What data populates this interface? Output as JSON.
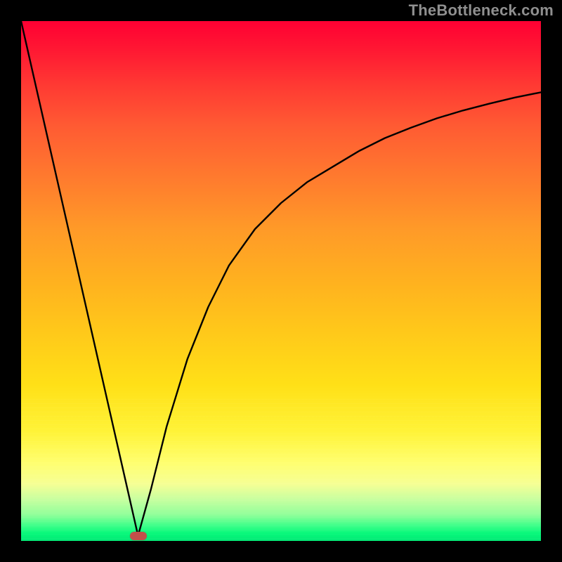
{
  "watermark": "TheBottleneck.com",
  "marker": {
    "x_pct": 22.5,
    "y_pct": 99.0,
    "color": "#c34f4a"
  },
  "chart_data": {
    "type": "line",
    "title": "",
    "xlabel": "",
    "ylabel": "",
    "xlim": [
      0,
      100
    ],
    "ylim": [
      0,
      100
    ],
    "annotations": [
      {
        "text": "TheBottleneck.com",
        "pos": "top-right"
      }
    ],
    "background_gradient": {
      "orientation": "vertical",
      "stops": [
        {
          "pos": 0,
          "color": "#ff0033"
        },
        {
          "pos": 50,
          "color": "#ffb11f"
        },
        {
          "pos": 85,
          "color": "#ffff70"
        },
        {
          "pos": 100,
          "color": "#04e876"
        }
      ]
    },
    "marker": {
      "x": 22.5,
      "y": 1,
      "shape": "rounded-rect",
      "color": "#c34f4a"
    },
    "series": [
      {
        "name": "left-segment",
        "x": [
          0,
          5,
          10,
          15,
          20,
          22.5
        ],
        "values": [
          100,
          78,
          56,
          34,
          12,
          1
        ]
      },
      {
        "name": "right-segment",
        "x": [
          22.5,
          25,
          28,
          32,
          36,
          40,
          45,
          50,
          55,
          60,
          65,
          70,
          75,
          80,
          85,
          90,
          95,
          100
        ],
        "values": [
          1,
          10,
          22,
          35,
          45,
          53,
          60,
          65,
          69,
          72,
          75,
          77.5,
          79.5,
          81.3,
          82.8,
          84.1,
          85.3,
          86.3
        ]
      }
    ]
  }
}
